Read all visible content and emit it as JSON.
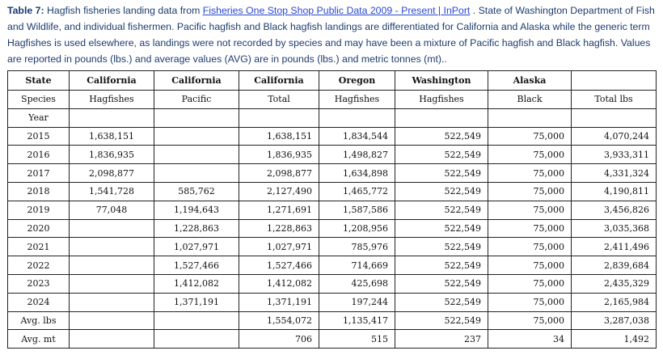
{
  "caption": {
    "label": "Table 7:",
    "text1": " Hagfish fisheries landing data from ",
    "link": "Fisheries One Stop Shop Public Data 2009 - Present | InPort",
    "text2": " . State of Washington Department of Fish and Wildlife, and individual fishermen. Pacific hagfish and Black hagfish landings are differentiated for California and Alaska while the generic term Hagfishes is used elsewhere, as landings were not recorded by species and may have been a mixture of Pacific hagfish and Black hagfish. Values are reported in pounds (lbs.) and average values (AVG) are in pounds (lbs.) and metric tonnes (mt).."
  },
  "table": {
    "state_row": [
      "State",
      "California",
      "California",
      "California",
      "Oregon",
      "Washington",
      "Alaska",
      ""
    ],
    "species_row": [
      "Species",
      "Hagfishes",
      "Pacific",
      "Total",
      "Hagfishes",
      "Hagfishes",
      "Black",
      "Total lbs"
    ],
    "year_row": [
      "Year",
      "",
      "",
      "",
      "",
      "",
      "",
      ""
    ],
    "rows": [
      [
        "2015",
        "1,638,151",
        "",
        "1,638,151",
        "1,834,544",
        "522,549",
        "75,000",
        "4,070,244"
      ],
      [
        "2016",
        "1,836,935",
        "",
        "1,836,935",
        "1,498,827",
        "522,549",
        "75,000",
        "3,933,311"
      ],
      [
        "2017",
        "2,098,877",
        "",
        "2,098,877",
        "1,634,898",
        "522,549",
        "75,000",
        "4,331,324"
      ],
      [
        "2018",
        "1,541,728",
        "585,762",
        "2,127,490",
        "1,465,772",
        "522,549",
        "75,000",
        "4,190,811"
      ],
      [
        "2019",
        "77,048",
        "1,194,643",
        "1,271,691",
        "1,587,586",
        "522,549",
        "75,000",
        "3,456,826"
      ],
      [
        "2020",
        "",
        "1,228,863",
        "1,228,863",
        "1,208,956",
        "522,549",
        "75,000",
        "3,035,368"
      ],
      [
        "2021",
        "",
        "1,027,971",
        "1,027,971",
        "785,976",
        "522,549",
        "75,000",
        "2,411,496"
      ],
      [
        "2022",
        "",
        "1,527,466",
        "1,527,466",
        "714,669",
        "522,549",
        "75,000",
        "2,839,684"
      ],
      [
        "2023",
        "",
        "1,412,082",
        "1,412,082",
        "425,698",
        "522,549",
        "75,000",
        "2,435,329"
      ],
      [
        "2024",
        "",
        "1,371,191",
        "1,371,191",
        "197,244",
        "522,549",
        "75,000",
        "2,165,984"
      ],
      [
        "Avg. lbs",
        "",
        "",
        "1,554,072",
        "1,135,417",
        "522,549",
        "75,000",
        "3,287,038"
      ],
      [
        "Avg. mt",
        "",
        "",
        "706",
        "515",
        "237",
        "34",
        "1,492"
      ]
    ]
  }
}
